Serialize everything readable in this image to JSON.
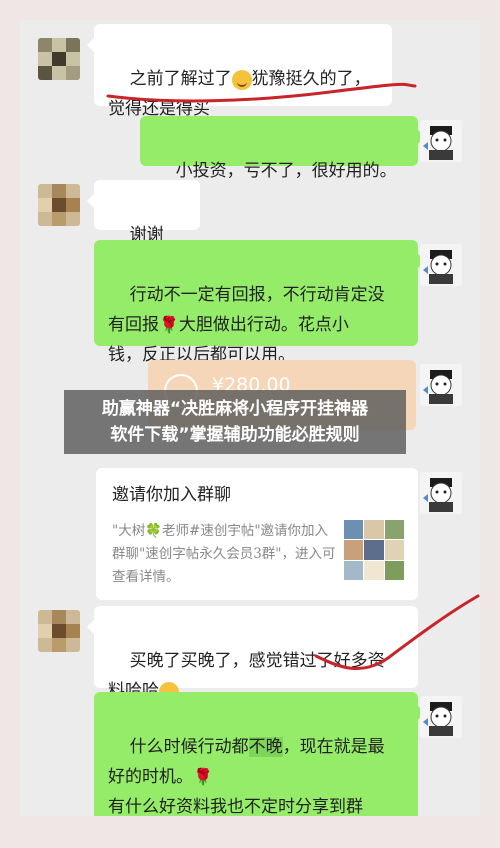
{
  "messages": {
    "m1": "之前了解过了",
    "m1b": "犹豫挺久的了，",
    "m1c": "觉得还是得买",
    "m2": "小投资，亏不了，很好用的。",
    "m3": "谢谢啦！",
    "m4a": "行动不一定有回报，不行动肯定没",
    "m4b": "有回报",
    "m4c": "大胆做出行动。花点小",
    "m4d": "钱，反正以后都可以用。",
    "transfer_amount": "¥280.00",
    "card_title": "邀请你加入群聊",
    "card_desc_a": "\"大树",
    "card_desc_b": "老师#速创宇帖\"邀请你加入群聊\"速创字帖永久会员3群\"，进入可查看详情。",
    "m6a": "买晚了买晚了，感觉错过了好多资",
    "m6b": "料哈哈",
    "m7a": "什么时候行动都",
    "m7hl": "不晚",
    "m7b": "，现在就是最",
    "m7c": "好的时机。",
    "m7d": "有什么好资料我也不定时分享到群",
    "m7e": "里。"
  },
  "banner": {
    "line1": "助赢神器“决胜麻将小程序开挂神器",
    "line2": "软件下载”掌握辅助功能必胜规则"
  },
  "colors": {
    "green_bubble": "#95ec69",
    "white_bubble": "#ffffff",
    "annotation_red": "#c8242a",
    "background": "#efe7e6"
  },
  "icons": {
    "laugh_emoji": "laugh-cry-emoji-icon",
    "rose": "rose-icon",
    "clover": "clover-icon",
    "transfer": "transfer-icon"
  }
}
